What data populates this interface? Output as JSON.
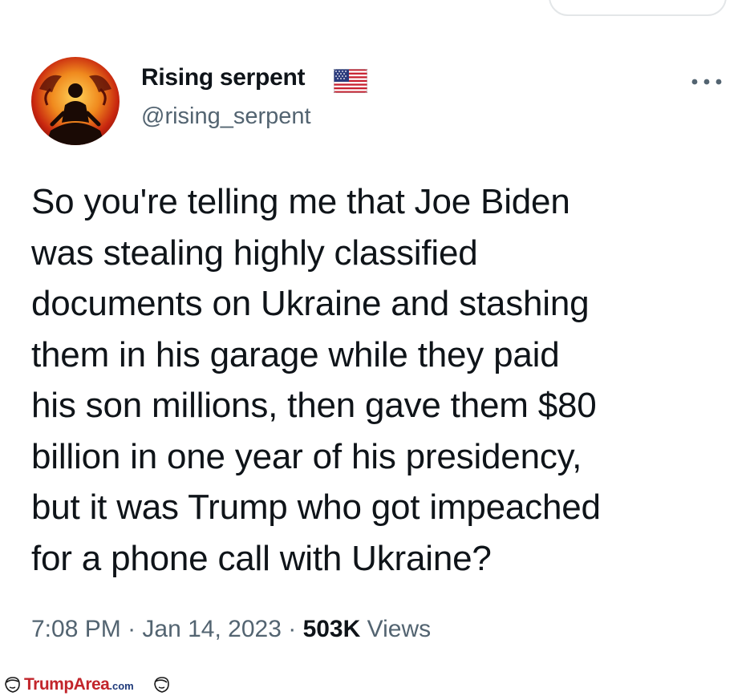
{
  "user": {
    "name": "Rising serpent",
    "handle": "@rising_serpent",
    "flag": "us-flag-icon"
  },
  "tweet": {
    "lines": [
      "So you're telling me that Joe Biden",
      "was stealing highly classified",
      "documents on Ukraine and stashing",
      "them in his garage while they paid",
      "his son millions, then gave them $80",
      "billion in one year of his presidency,",
      "but it was Trump who got impeached",
      "for a phone call with Ukraine?"
    ]
  },
  "meta": {
    "time": "7:08 PM",
    "date": "Jan 14, 2023",
    "separator": "·",
    "views_count": "503K",
    "views_label": "Views"
  },
  "watermark": {
    "brand": "TrumpArea",
    "suffix": ".com"
  },
  "colors": {
    "text_primary": "#0f1419",
    "text_secondary": "#536471",
    "watermark_red": "#c2252b",
    "watermark_blue": "#1f3a7a"
  }
}
